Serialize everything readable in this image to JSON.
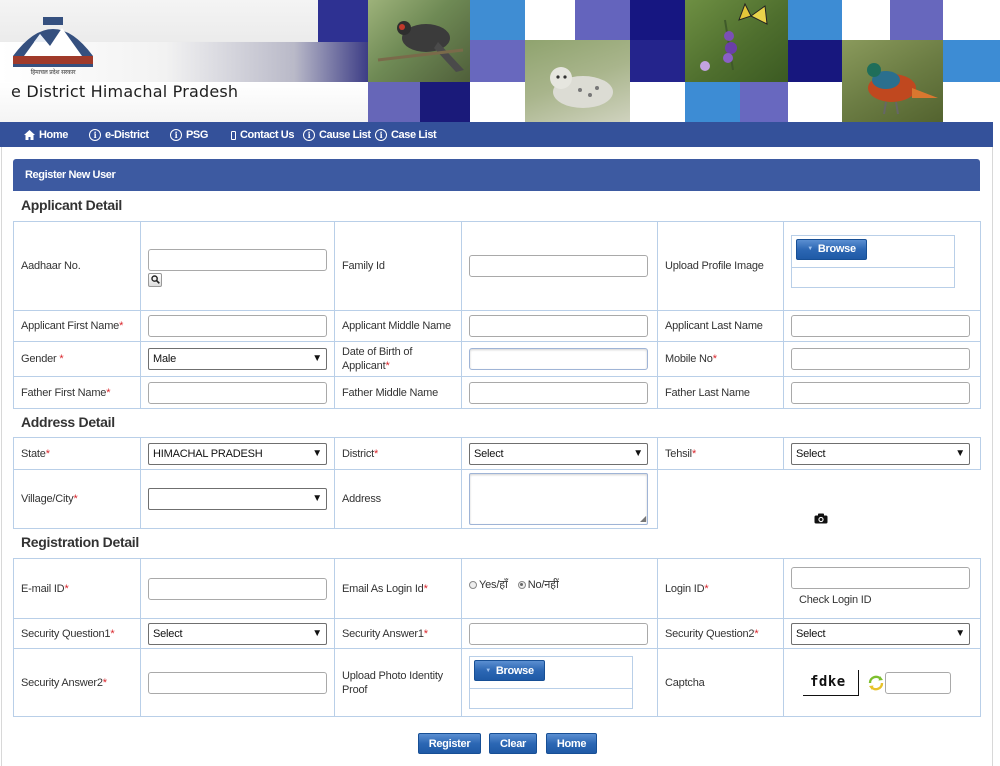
{
  "header": {
    "site_title": "e District Himachal Pradesh",
    "logo_icon": "himachal-emblem-icon"
  },
  "nav": {
    "items": [
      {
        "label": "Home",
        "icon": "home-icon"
      },
      {
        "label": "e-District",
        "icon": "info-icon"
      },
      {
        "label": "PSG",
        "icon": "info-icon"
      },
      {
        "label": "Contact Us",
        "icon": "phone-icon"
      },
      {
        "label": "Cause List",
        "icon": "info-icon"
      },
      {
        "label": "Case List",
        "icon": "info-icon"
      }
    ]
  },
  "panel": {
    "title": "Register New User"
  },
  "applicant": {
    "section_title": "Applicant Detail",
    "aadhaar_label": "Aadhaar No.",
    "family_id_label": "Family Id",
    "upload_profile_label": "Upload Profile Image",
    "first_name_label": "Applicant First Name",
    "middle_name_label": "Applicant Middle Name",
    "last_name_label": "Applicant Last Name",
    "gender_label": "Gender ",
    "gender_value": "Male",
    "dob_label_line1": "Date of Birth of",
    "dob_label_line2": "Applicant",
    "mobile_label": "Mobile No",
    "father_first_label": "Father First Name",
    "father_middle_label": "Father Middle Name",
    "father_last_label": "Father Last Name"
  },
  "address": {
    "section_title": "Address Detail",
    "state_label": "State",
    "state_value": "HIMACHAL PRADESH",
    "district_label": "District",
    "district_value": "Select",
    "tehsil_label": "Tehsil",
    "tehsil_value": "Select",
    "village_label": "Village/City",
    "village_value": "",
    "address_label": "Address"
  },
  "registration": {
    "section_title": "Registration Detail",
    "email_label": "E-mail ID",
    "email_login_label": "Email As Login Id",
    "radio_yes": "Yes/हाँ",
    "radio_no": "No/नहीं",
    "radio_selected": "no",
    "login_id_label": "Login ID",
    "check_login_label": "Check Login ID",
    "security_q1_label": "Security Question1",
    "security_q1_value": "Select",
    "security_a1_label": "Security Answer1",
    "security_q2_label": "Security Question2",
    "security_q2_value": "Select",
    "security_a2_label": "Security Answer2",
    "upload_identity_label_line1": "Upload Photo Identity",
    "upload_identity_label_line2": "Proof",
    "captcha_label": "Captcha",
    "captcha_text": "fdke"
  },
  "buttons": {
    "browse": "Browse",
    "register": "Register",
    "clear": "Clear",
    "home": "Home"
  },
  "colors": {
    "nav_bar": "#34519a",
    "panel_header": "#3d5aa1",
    "button": "#2c67b4",
    "required": "#d9262c",
    "table_border": "#b9cfe8"
  }
}
